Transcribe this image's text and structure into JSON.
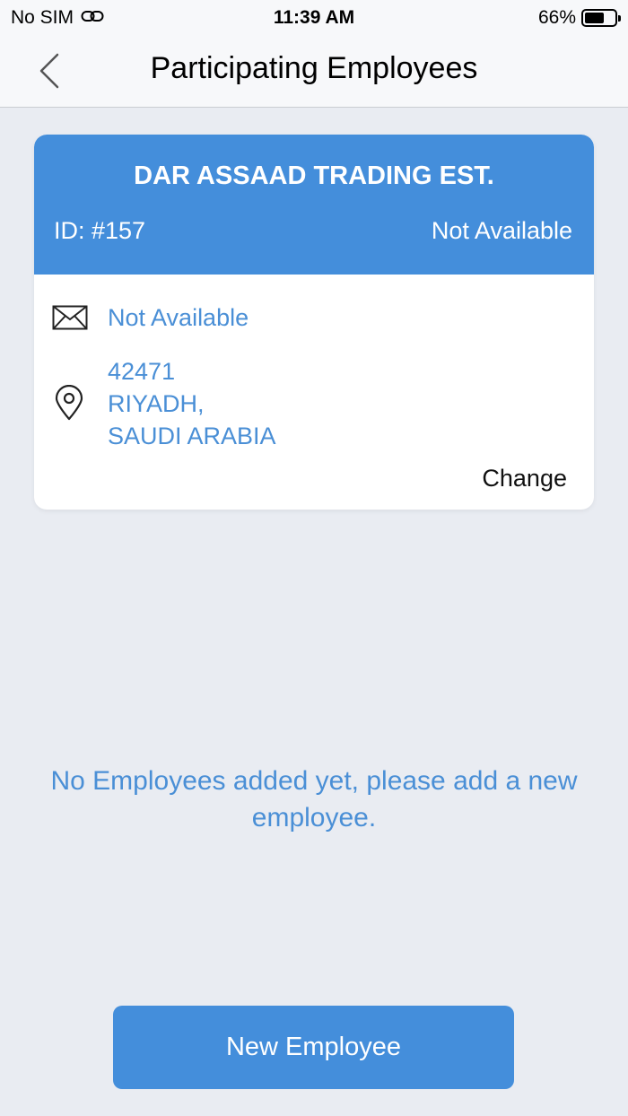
{
  "status_bar": {
    "carrier": "No SIM",
    "time": "11:39 AM",
    "battery_percent": "66%",
    "battery_level": 0.66,
    "link_icon": "link-icon"
  },
  "nav": {
    "title": "Participating Employees",
    "back_icon": "chevron-left-icon"
  },
  "company": {
    "name": "DAR ASSAAD TRADING EST.",
    "id": "ID: #157",
    "status": "Not Available",
    "email": "Not Available",
    "address": {
      "line1": "42471",
      "line2": "RIYADH,",
      "line3": "SAUDI ARABIA"
    },
    "change_label": "Change"
  },
  "empty_state": {
    "message": "No Employees added yet, please add a new employee."
  },
  "actions": {
    "new_employee_label": "New Employee"
  },
  "colors": {
    "accent": "#448edb",
    "link_text": "#4a8fd6",
    "background": "#e9ecf2"
  }
}
